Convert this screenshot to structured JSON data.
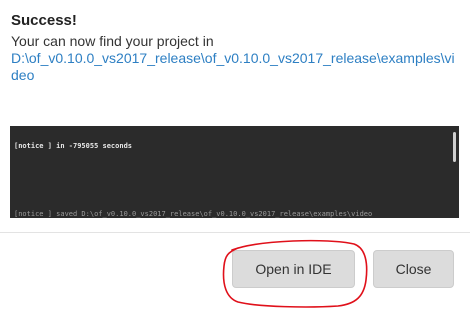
{
  "dialog": {
    "title": "Success!",
    "message": "Your can now find your project in",
    "project_path": "D:\\of_v0.10.0_vs2017_release\\of_v0.10.0_vs2017_release\\examples\\video"
  },
  "console": {
    "first_line": "[notice ] in -795055 seconds",
    "bottom_line": "[notice ] saved D:\\of_v0.10.0_vs2017_release\\of_v0.10.0_vs2017_release\\examples\\video"
  },
  "buttons": {
    "open_in_ide": "Open in IDE",
    "close": "Close"
  },
  "annotation": {
    "color": "#e0101a"
  }
}
